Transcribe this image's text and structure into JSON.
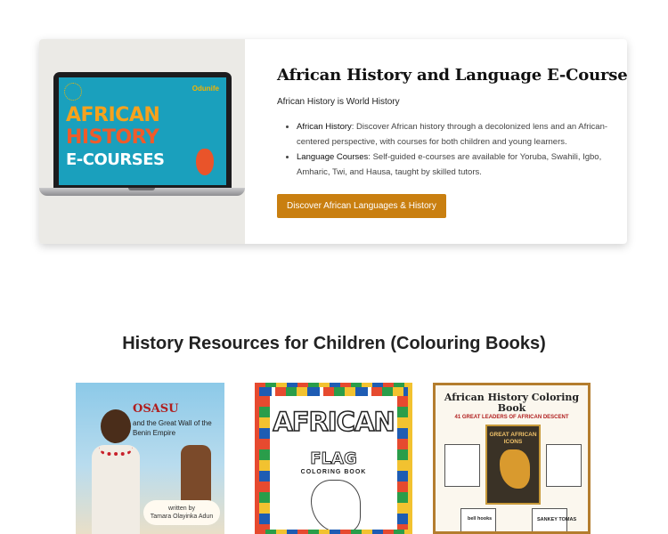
{
  "promo": {
    "laptop_screen": {
      "brand": "Odunife",
      "line1": "AFRICAN",
      "line2": "HISTORY",
      "line3": "E-COURSES"
    },
    "title": "African History and Language E-Courses",
    "subtitle": "African History is World History",
    "bullets": [
      {
        "term": "African History",
        "text": ": Discover African history through a decolonized lens and an African-centered perspective, with courses for both children and young learners."
      },
      {
        "term": "Language Courses",
        "text": ": Self-guided e-courses are available for Yoruba, Swahili, Igbo, Amharic, Twi, and Hausa, taught by skilled tutors."
      }
    ],
    "cta_label": "Discover African Languages & History"
  },
  "resources": {
    "heading": "History Resources for Children (Colouring Books)",
    "books": [
      {
        "title": "OSASU",
        "subtitle": "and the Great Wall of the Benin Empire",
        "author_line1": "written by",
        "author_line2": "Tamara Olayinka Adun"
      },
      {
        "title": "AFRICAN",
        "word": "FLAG",
        "subtitle": "COLORING BOOK"
      },
      {
        "title": "African History Coloring Book",
        "subtitle": "41 GREAT LEADERS OF AFRICAN DESCENT",
        "center_label": "GREAT AFRICAN ICONS",
        "label_a": "bell hooks",
        "label_b": "SANKEY TOMAS"
      }
    ]
  }
}
